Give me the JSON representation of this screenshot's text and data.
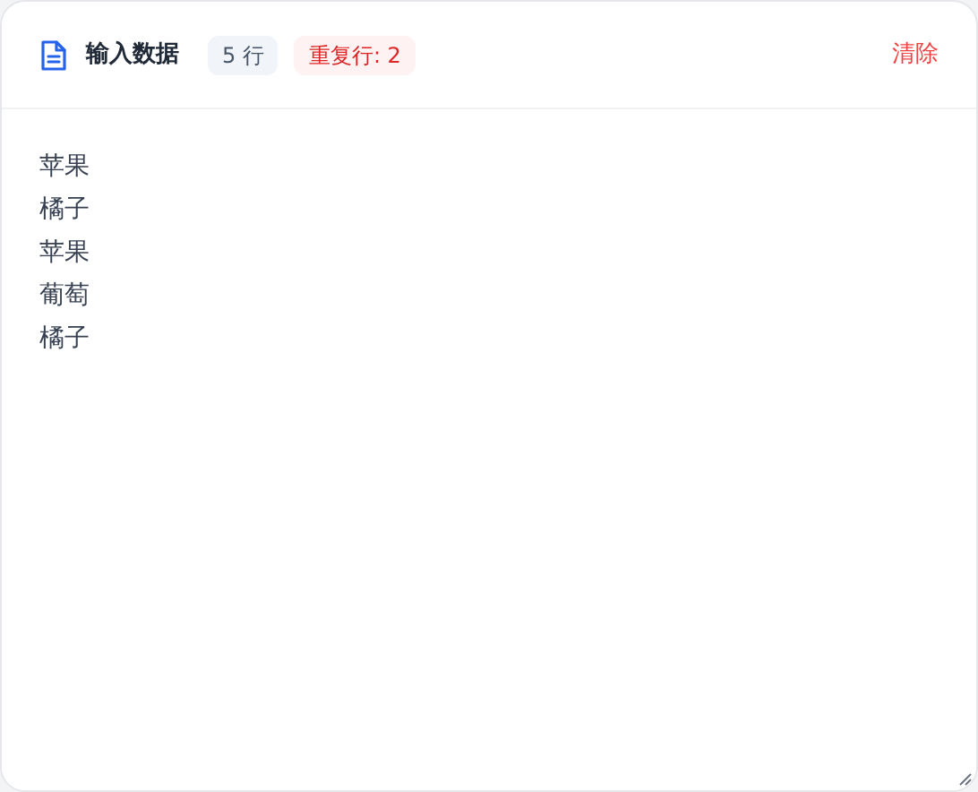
{
  "header": {
    "title": "输入数据",
    "line_count": "5 行",
    "duplicates": "重复行: 2",
    "clear_button": "清除"
  },
  "input": {
    "lines": [
      "苹果",
      "橘子",
      "苹果",
      "葡萄",
      "橘子"
    ]
  }
}
